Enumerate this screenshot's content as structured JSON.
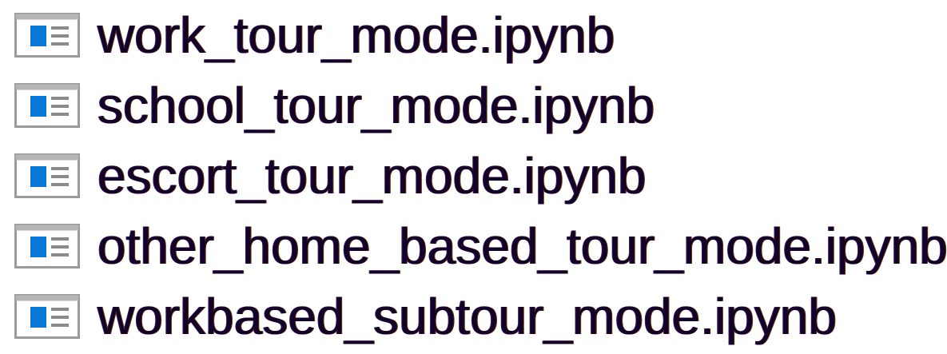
{
  "files": [
    {
      "name": "work_tour_mode.ipynb",
      "icon": "notebook-file-icon"
    },
    {
      "name": "school_tour_mode.ipynb",
      "icon": "notebook-file-icon"
    },
    {
      "name": "escort_tour_mode.ipynb",
      "icon": "notebook-file-icon"
    },
    {
      "name": "other_home_based_tour_mode.ipynb",
      "icon": "notebook-file-icon"
    },
    {
      "name": "workbased_subtour_mode.ipynb",
      "icon": "notebook-file-icon"
    }
  ],
  "colors": {
    "icon_frame": "#9a9a9a",
    "icon_fill": "#ffffff",
    "icon_accent": "#0a78d7",
    "icon_lines": "#8a8a8a",
    "text": "#15002a"
  }
}
